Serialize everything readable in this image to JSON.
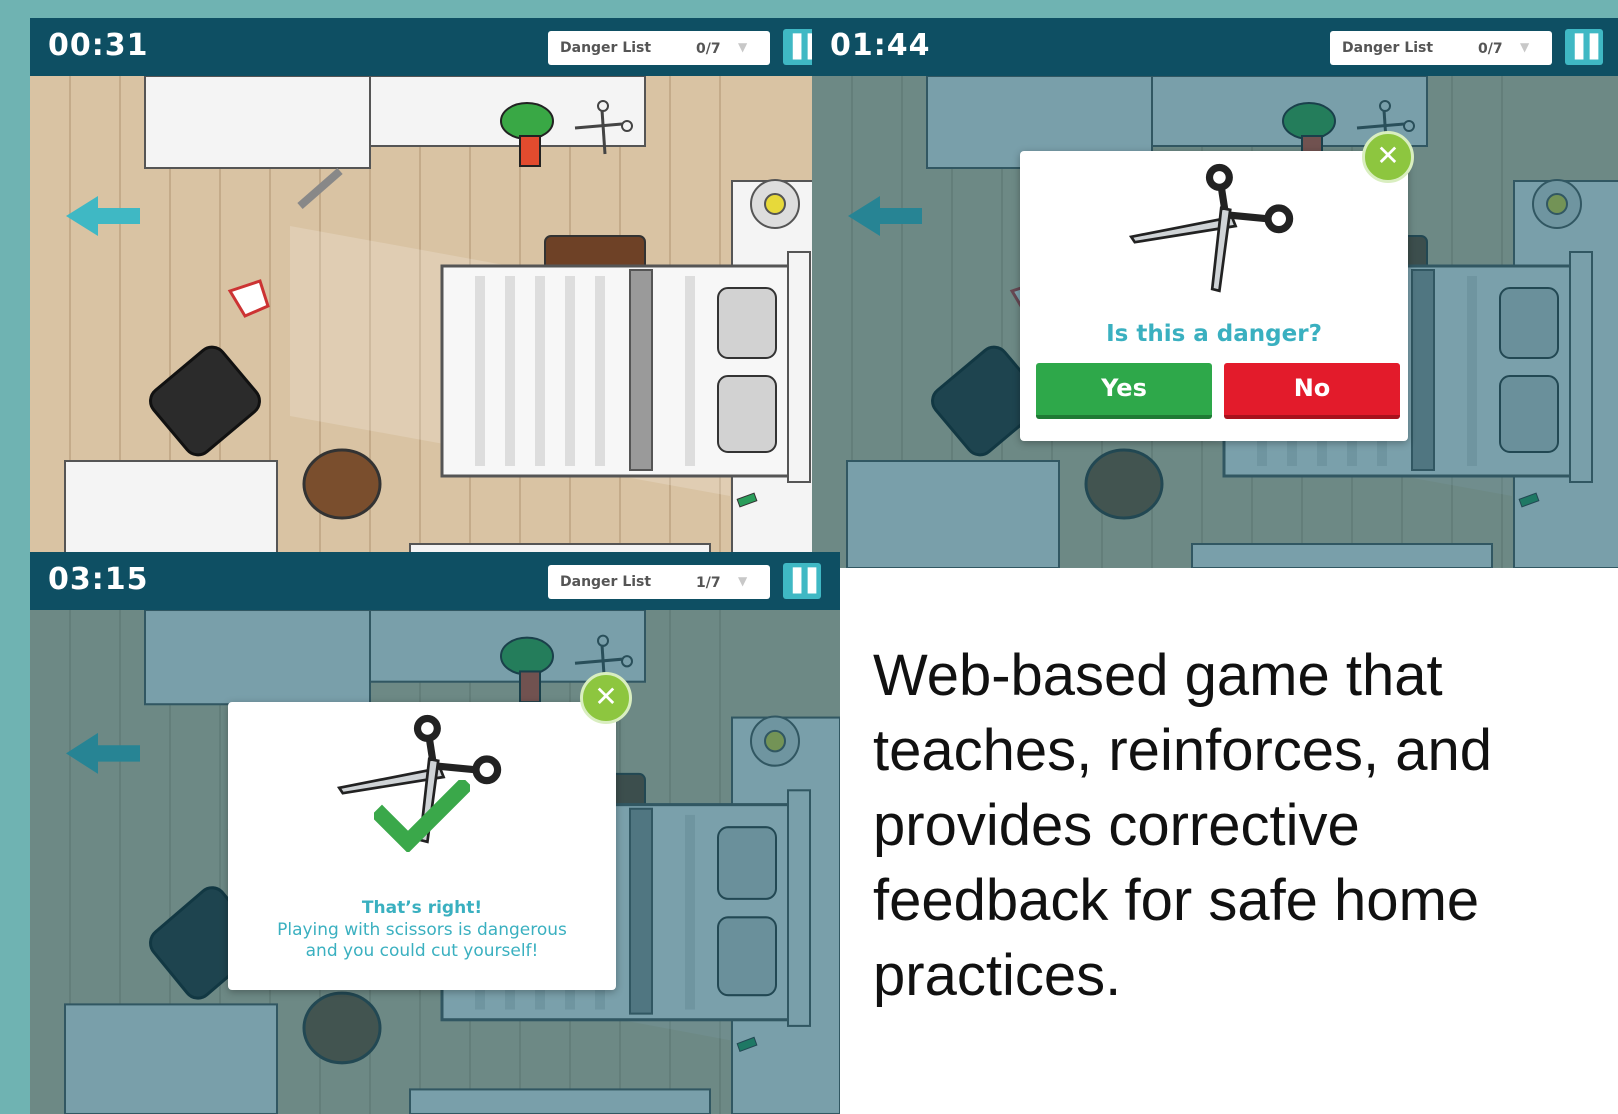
{
  "panels": [
    {
      "timer": "00:31",
      "danger_list_label": "Danger List",
      "danger_count": "0/7"
    },
    {
      "timer": "01:44",
      "danger_list_label": "Danger List",
      "danger_count": "0/7"
    },
    {
      "timer": "03:15",
      "danger_list_label": "Danger List",
      "danger_count": "1/7"
    }
  ],
  "prompt_popup": {
    "question": "Is this a danger?",
    "yes_label": "Yes",
    "no_label": "No"
  },
  "feedback_popup": {
    "title": "That’s right!",
    "line1": "Playing with scissors is dangerous",
    "line2": "and you could cut yourself!"
  },
  "caption": "Web-based game that teaches, reinforces, and provides corrective feedback for safe home practices.",
  "colors": {
    "background": "#6fb3b2",
    "hud": "#0e4f63",
    "accent": "#3ab0c0",
    "yes": "#2ea84a",
    "no": "#e31b2b",
    "close": "#8dc63f"
  },
  "icons": [
    "left-arrow-icon",
    "pause-icon",
    "close-icon",
    "scissors-icon",
    "checkmark-icon",
    "chevron-down-icon"
  ]
}
